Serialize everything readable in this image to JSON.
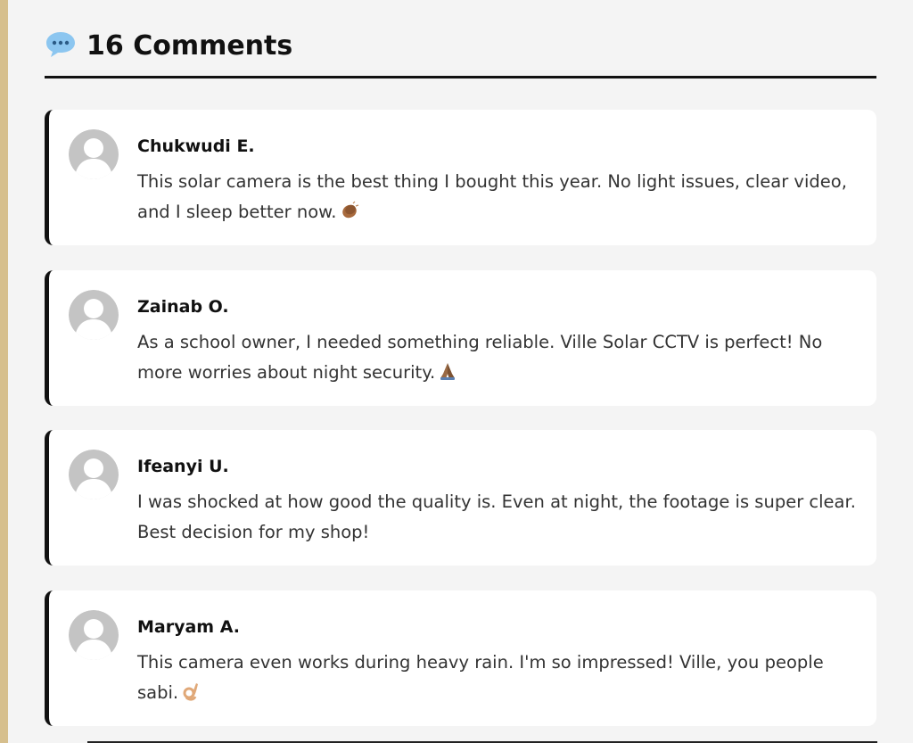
{
  "header": {
    "icon": "speech-bubble-icon",
    "title": "16 Comments"
  },
  "colors": {
    "accent_strip": "#d6bf8d",
    "card_border": "#111111",
    "avatar": "#c4c4c4",
    "bubble": "#8cc6f0"
  },
  "comments": [
    {
      "author": "Chukwudi E.",
      "text": "This solar camera is the best thing I bought this year. No light issues, clear video, and I sleep better now.",
      "emoji": "clapping-hands-icon"
    },
    {
      "author": "Zainab O.",
      "text": "As a school owner, I needed something reliable. Ville Solar CCTV is perfect! No more worries about night security.",
      "emoji": "folded-hands-icon"
    },
    {
      "author": "Ifeanyi U.",
      "text": "I was shocked at how good the quality is. Even at night, the footage is super clear. Best decision for my shop!",
      "emoji": ""
    },
    {
      "author": "Maryam A.",
      "text": "This camera even works during heavy rain. I'm so impressed! Ville, you people sabi.",
      "emoji": "ok-hand-icon"
    }
  ]
}
